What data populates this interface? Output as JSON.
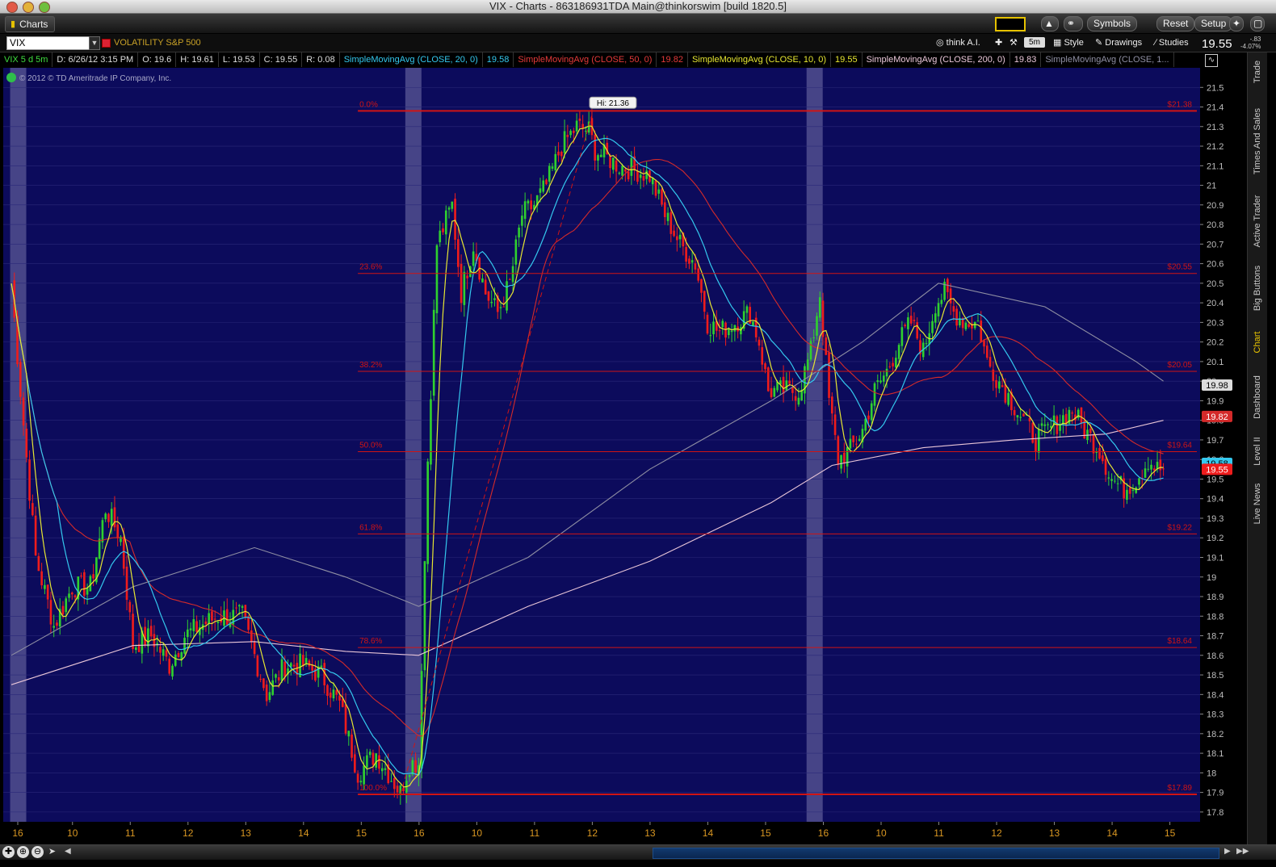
{
  "window": {
    "title": "VIX - Charts - 863186931TDA Main@thinkorswim [build 1820.5]"
  },
  "toolbar": {
    "charts_tab": "Charts",
    "symbols": "Symbols",
    "reset": "Reset",
    "setup": "Setup"
  },
  "symbol_row": {
    "symbol": "VIX",
    "description": "VOLATILITY S&P 500",
    "think_ai": "think A.I.",
    "timeframe": "5m",
    "style": "Style",
    "drawings": "Drawings",
    "studies": "Studies",
    "last": "19.55",
    "change": "-.83",
    "change_pct": "-4.07%"
  },
  "info_row": {
    "period": "VIX 5 d 5m",
    "date": "D: 6/26/12 3:15 PM",
    "open": "O: 19.6",
    "high": "H: 19.61",
    "low": "L: 19.53",
    "close": "C: 19.55",
    "range": "R: 0.08",
    "sma20_label": "SimpleMovingAvg (CLOSE, 20, 0)",
    "sma20_val": "19.58",
    "sma50_label": "SimpleMovingAvg (CLOSE, 50, 0)",
    "sma50_val": "19.82",
    "sma10_label": "SimpleMovingAvg (CLOSE, 10, 0)",
    "sma10_val": "19.55",
    "sma200_label": "SimpleMovingAvg (CLOSE, 200, 0)",
    "sma200_val": "19.83",
    "sma_extra_label": "SimpleMovingAvg (CLOSE, 1..."
  },
  "sidebar": {
    "tabs": [
      "Trade",
      "Times And Sales",
      "Active Trader",
      "Big Buttons",
      "Chart",
      "Dashboard",
      "Level II",
      "Live News"
    ],
    "active": "Chart"
  },
  "colors": {
    "bg": "#0c0b5c",
    "session": "#4d4a8c",
    "up": "#2fd02f",
    "down": "#ee1c1c",
    "sma10": "#e6e632",
    "sma20": "#34c8ee",
    "sma50": "#d42a2a",
    "sma200": "#e9c6d8",
    "sma_gray": "#8f8fa3",
    "fib": "#d01414",
    "axis_text": "#bdbdbd",
    "x_text": "#d99722"
  },
  "chart_data": {
    "type": "candlestick",
    "title": "",
    "copyright": "© 2012 © TD Ameritrade IP Company, Inc.",
    "y_axis": {
      "min": 17.8,
      "max": 21.5,
      "step": 0.1,
      "ticks": [
        "21.5",
        "21.4",
        "21.3",
        "21.2",
        "21.1",
        "21",
        "20.9",
        "20.8",
        "20.7",
        "20.6",
        "20.5",
        "20.4",
        "20.3",
        "20.2",
        "20.1",
        "20",
        "19.9",
        "19.8",
        "19.7",
        "19.6",
        "19.5",
        "19.4",
        "19.3",
        "19.2",
        "19.1",
        "19",
        "18.9",
        "18.8",
        "18.7",
        "18.6",
        "18.5",
        "18.4",
        "18.3",
        "18.2",
        "18.1",
        "18",
        "17.9",
        "17.8"
      ]
    },
    "x_axis": {
      "bar_count": 390,
      "ticks": [
        {
          "bar": 0,
          "label": "16"
        },
        {
          "bar": 18,
          "label": "10"
        },
        {
          "bar": 37,
          "label": "11"
        },
        {
          "bar": 56,
          "label": "12"
        },
        {
          "bar": 75,
          "label": "13"
        },
        {
          "bar": 94,
          "label": "14"
        },
        {
          "bar": 113,
          "label": "15"
        },
        {
          "bar": 132,
          "label": "16"
        },
        {
          "bar": 151,
          "label": "10"
        },
        {
          "bar": 170,
          "label": "11"
        },
        {
          "bar": 189,
          "label": "12"
        },
        {
          "bar": 208,
          "label": "13"
        },
        {
          "bar": 227,
          "label": "14"
        },
        {
          "bar": 246,
          "label": "15"
        },
        {
          "bar": 265,
          "label": "16"
        },
        {
          "bar": 284,
          "label": "10"
        },
        {
          "bar": 303,
          "label": "11"
        },
        {
          "bar": 322,
          "label": "12"
        },
        {
          "bar": 341,
          "label": "13"
        },
        {
          "bar": 360,
          "label": "14"
        },
        {
          "bar": 379,
          "label": "15"
        }
      ]
    },
    "session_breaks": [
      2,
      132,
      264
    ],
    "price_path": [
      [
        0,
        20.5
      ],
      [
        3,
        19.95
      ],
      [
        8,
        19.1
      ],
      [
        14,
        18.75
      ],
      [
        20,
        18.95
      ],
      [
        26,
        18.95
      ],
      [
        31,
        19.35
      ],
      [
        36,
        19.2
      ],
      [
        40,
        18.65
      ],
      [
        46,
        18.7
      ],
      [
        52,
        18.55
      ],
      [
        57,
        18.7
      ],
      [
        62,
        18.75
      ],
      [
        68,
        18.8
      ],
      [
        76,
        18.8
      ],
      [
        84,
        18.4
      ],
      [
        90,
        18.55
      ],
      [
        96,
        18.55
      ],
      [
        102,
        18.5
      ],
      [
        108,
        18.35
      ],
      [
        114,
        18.0
      ],
      [
        120,
        18.1
      ],
      [
        124,
        18.0
      ],
      [
        128,
        17.9
      ],
      [
        131,
        18.05
      ],
      [
        134,
        18.05
      ],
      [
        137,
        19.6
      ],
      [
        140,
        20.7
      ],
      [
        145,
        20.9
      ],
      [
        148,
        20.45
      ],
      [
        152,
        20.7
      ],
      [
        156,
        20.45
      ],
      [
        160,
        20.35
      ],
      [
        164,
        20.5
      ],
      [
        168,
        20.85
      ],
      [
        172,
        20.9
      ],
      [
        176,
        21.0
      ],
      [
        181,
        21.2
      ],
      [
        186,
        21.3
      ],
      [
        190,
        21.28
      ],
      [
        192,
        21.18
      ],
      [
        195,
        21.15
      ],
      [
        200,
        21.1
      ],
      [
        205,
        21.08
      ],
      [
        210,
        21.05
      ],
      [
        215,
        20.85
      ],
      [
        220,
        20.7
      ],
      [
        225,
        20.6
      ],
      [
        229,
        20.3
      ],
      [
        233,
        20.25
      ],
      [
        238,
        20.3
      ],
      [
        243,
        20.35
      ],
      [
        246,
        20.2
      ],
      [
        249,
        19.95
      ],
      [
        254,
        19.95
      ],
      [
        259,
        19.95
      ],
      [
        263,
        20.15
      ],
      [
        266,
        20.45
      ],
      [
        269,
        19.9
      ],
      [
        272,
        19.6
      ],
      [
        276,
        19.65
      ],
      [
        280,
        19.75
      ],
      [
        284,
        19.95
      ],
      [
        288,
        20.05
      ],
      [
        292,
        20.2
      ],
      [
        296,
        20.3
      ],
      [
        300,
        20.15
      ],
      [
        304,
        20.4
      ],
      [
        307,
        20.45
      ],
      [
        310,
        20.35
      ],
      [
        314,
        20.3
      ],
      [
        318,
        20.3
      ],
      [
        321,
        20.1
      ],
      [
        325,
        20.0
      ],
      [
        329,
        19.9
      ],
      [
        333,
        19.8
      ],
      [
        337,
        19.7
      ],
      [
        341,
        19.75
      ],
      [
        345,
        19.8
      ],
      [
        349,
        19.85
      ],
      [
        353,
        19.75
      ],
      [
        358,
        19.65
      ],
      [
        362,
        19.5
      ],
      [
        366,
        19.45
      ],
      [
        370,
        19.5
      ],
      [
        374,
        19.6
      ],
      [
        377,
        19.55
      ],
      [
        379,
        19.55
      ]
    ],
    "fibonacci": [
      {
        "level": "0.0%",
        "price": 21.38,
        "label": "$21.38"
      },
      {
        "level": "23.6%",
        "price": 20.55,
        "label": "$20.55"
      },
      {
        "level": "38.2%",
        "price": 20.05,
        "label": "$20.05"
      },
      {
        "level": "50.0%",
        "price": 19.64,
        "label": "$19.64"
      },
      {
        "level": "61.8%",
        "price": 19.22,
        "label": "$19.22"
      },
      {
        "level": "78.6%",
        "price": 18.64,
        "label": "$18.64"
      },
      {
        "level": "100.0%",
        "price": 17.89,
        "label": "$17.89"
      }
    ],
    "fib_start_bar": 114,
    "high_marker": {
      "label": "Hi: 21.36",
      "bar": 191,
      "price": 21.36
    },
    "sma200_path": [
      [
        0,
        18.45
      ],
      [
        40,
        18.65
      ],
      [
        80,
        18.67
      ],
      [
        110,
        18.62
      ],
      [
        134,
        18.6
      ],
      [
        170,
        18.85
      ],
      [
        210,
        19.08
      ],
      [
        250,
        19.38
      ],
      [
        270,
        19.57
      ],
      [
        300,
        19.66
      ],
      [
        330,
        19.7
      ],
      [
        360,
        19.73
      ],
      [
        379,
        19.8
      ]
    ],
    "sma_gray_path": [
      [
        0,
        18.6
      ],
      [
        40,
        18.95
      ],
      [
        80,
        19.15
      ],
      [
        110,
        19.0
      ],
      [
        134,
        18.85
      ],
      [
        170,
        19.1
      ],
      [
        210,
        19.55
      ],
      [
        250,
        19.9
      ],
      [
        280,
        20.2
      ],
      [
        305,
        20.5
      ],
      [
        340,
        20.38
      ],
      [
        370,
        20.1
      ],
      [
        379,
        20.0
      ]
    ],
    "price_labels": [
      {
        "value": 19.98,
        "text": "19.98",
        "bg": "#dddddd",
        "fg": "#000000"
      },
      {
        "value": 19.82,
        "text": "19.82",
        "bg": "#d42a2a",
        "fg": "#ffffff"
      },
      {
        "value": 19.58,
        "text": "19.58",
        "bg": "#34c8ee",
        "fg": "#000000"
      },
      {
        "value": 19.55,
        "text": "19.55",
        "bg": "#ee1c1c",
        "fg": "#ffffff"
      }
    ]
  }
}
